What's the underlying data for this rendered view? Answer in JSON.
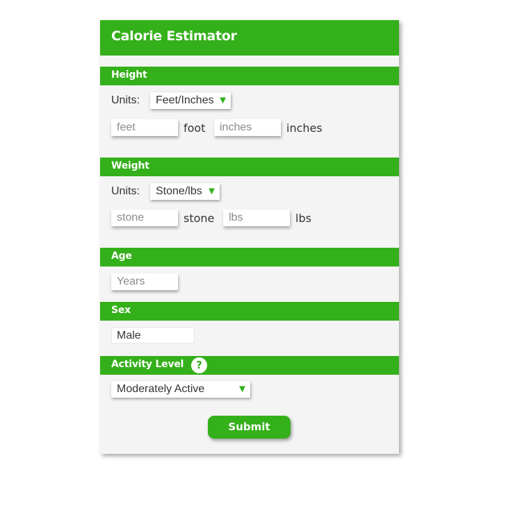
{
  "title": "Calorie Estimator",
  "height": {
    "heading": "Height",
    "units_label": "Units:",
    "units_value": "Feet/Inches",
    "feet_placeholder": "feet",
    "feet_unit": "foot",
    "inches_placeholder": "inches",
    "inches_unit": "inches"
  },
  "weight": {
    "heading": "Weight",
    "units_label": "Units:",
    "units_value": "Stone/lbs",
    "stone_placeholder": "stone",
    "stone_unit": "stone",
    "lbs_placeholder": "lbs",
    "lbs_unit": "lbs"
  },
  "age": {
    "heading": "Age",
    "placeholder": "Years"
  },
  "sex": {
    "heading": "Sex",
    "value": "Male"
  },
  "activity": {
    "heading": "Activity Level",
    "help_icon": "?",
    "value": "Moderately Active"
  },
  "submit_label": "Submit",
  "dropdown_arrow": "▼",
  "colors": {
    "accent": "#34b01a",
    "panel": "#f4f4f4",
    "text": "#333333"
  }
}
